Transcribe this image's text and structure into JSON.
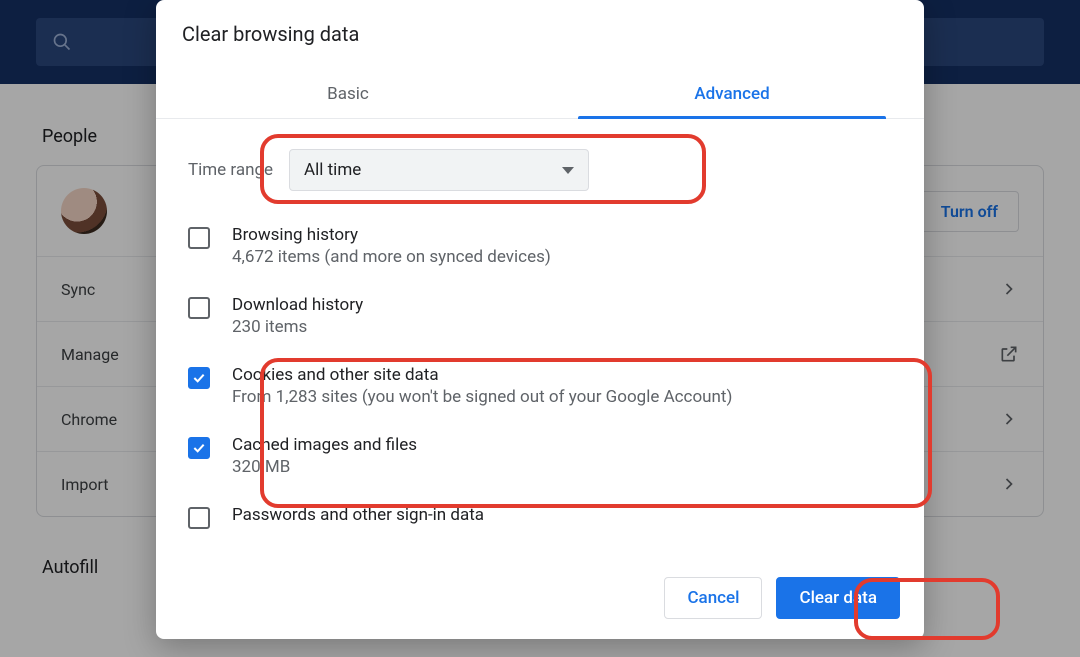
{
  "search": {
    "placeholder": ""
  },
  "settings": {
    "people_label": "People",
    "autofill_label": "Autofill",
    "turn_off": "Turn off",
    "rows": {
      "sync": "Sync",
      "manage": "Manage",
      "chrome": "Chrome",
      "import": "Import"
    }
  },
  "dialog": {
    "title": "Clear browsing data",
    "tabs": {
      "basic": "Basic",
      "advanced": "Advanced"
    },
    "time_range_label": "Time range",
    "time_range_value": "All time",
    "options": [
      {
        "title": "Browsing history",
        "sub": "4,672 items (and more on synced devices)",
        "checked": false
      },
      {
        "title": "Download history",
        "sub": "230 items",
        "checked": false
      },
      {
        "title": "Cookies and other site data",
        "sub": "From 1,283 sites (you won't be signed out of your Google Account)",
        "checked": true
      },
      {
        "title": "Cached images and files",
        "sub": "320 MB",
        "checked": true
      },
      {
        "title": "Passwords and other sign-in data",
        "sub": "",
        "checked": false
      }
    ],
    "cancel": "Cancel",
    "confirm": "Clear data"
  }
}
